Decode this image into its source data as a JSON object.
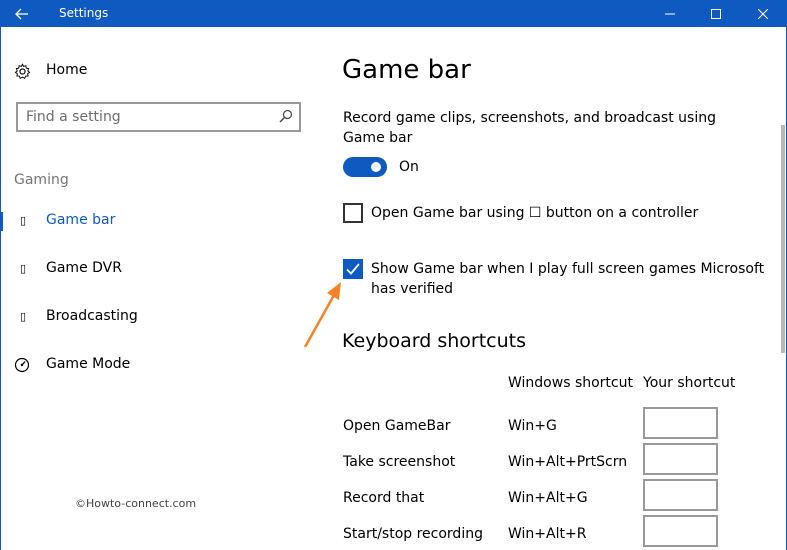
{
  "window": {
    "title": "Settings"
  },
  "sidebar": {
    "home_label": "Home",
    "search_placeholder": "Find a setting",
    "section_label": "Gaming",
    "items": [
      {
        "label": "Game bar",
        "icon": "game-bar-icon",
        "active": true
      },
      {
        "label": "Game DVR",
        "icon": "game-dvr-icon",
        "active": false
      },
      {
        "label": "Broadcasting",
        "icon": "broadcasting-icon",
        "active": false
      },
      {
        "label": "Game Mode",
        "icon": "game-mode-icon",
        "active": false
      }
    ],
    "watermark": "©Howto-connect.com"
  },
  "main": {
    "title": "Game bar",
    "record_desc": "Record game clips, screenshots, and broadcast using Game bar",
    "toggle_state": "On",
    "option_controller": "Open Game bar using ☐ button on a controller",
    "option_controller_checked": false,
    "option_fullscreen": "Show Game bar when I play full screen games Microsoft has verified",
    "option_fullscreen_checked": true,
    "keyboard_heading": "Keyboard shortcuts",
    "col_windows": "Windows shortcut",
    "col_yours": "Your shortcut",
    "shortcuts": [
      {
        "name": "Open GameBar",
        "win": "Win+G",
        "yours": ""
      },
      {
        "name": "Take screenshot",
        "win": "Win+Alt+PrtScrn",
        "yours": ""
      },
      {
        "name": "Record that",
        "win": "Win+Alt+G",
        "yours": ""
      },
      {
        "name": "Start/stop recording",
        "win": "Win+Alt+R",
        "yours": ""
      }
    ]
  },
  "colors": {
    "accent": "#0e5ac0",
    "annotation_arrow": "#f5822a"
  }
}
